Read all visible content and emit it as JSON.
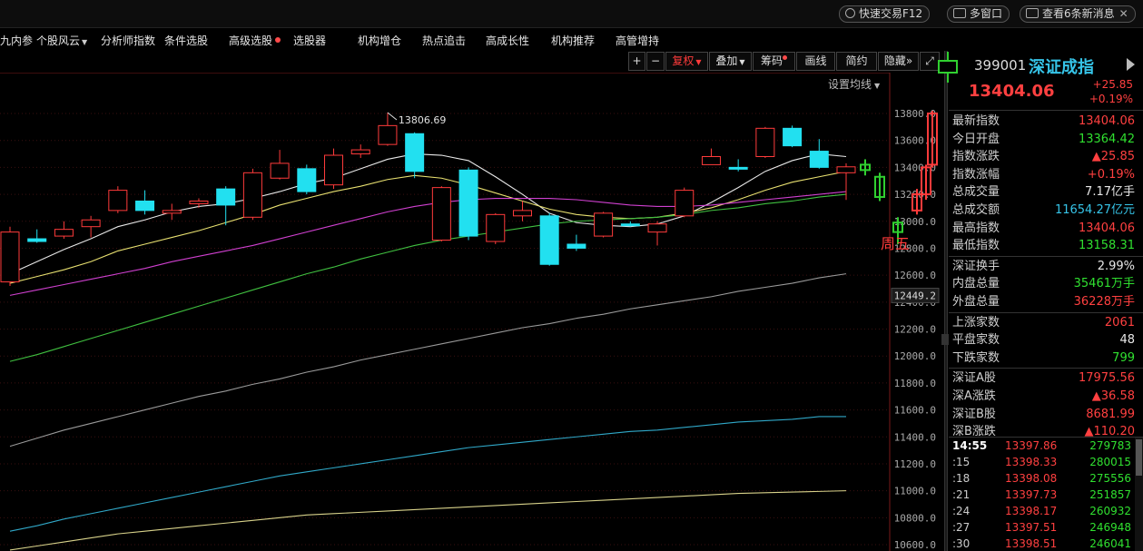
{
  "topbar": {
    "quick_trade": "快速交易F12",
    "multi_window": "多窗口",
    "news": "查看6条新消息"
  },
  "menu": [
    {
      "label": "九内参"
    },
    {
      "label": "个股风云",
      "caret": true
    },
    {
      "label": "分析师指数"
    },
    {
      "label": "条件选股"
    },
    {
      "label": "高级选股",
      "dot": true
    },
    {
      "label": "选股器"
    },
    {
      "label": "机构增仓"
    },
    {
      "label": "热点追击"
    },
    {
      "label": "高成长性"
    },
    {
      "label": "机构推荐"
    },
    {
      "label": "高管增持"
    }
  ],
  "toolbar": {
    "plus": "+",
    "minus": "−",
    "fuquan": "复权",
    "overlay": "叠加",
    "chips": "筹码",
    "draw": "画线",
    "simple": "简约",
    "hide": "隐藏",
    "hide_arrow": "»",
    "fullscreen": "⤢",
    "ma_setting": "设置均线"
  },
  "chart_data": {
    "type": "candlestick",
    "ylim": [
      10600,
      13900
    ],
    "y_ticks": [
      13800,
      13600,
      13400,
      13200,
      13000,
      12800,
      12600,
      12400,
      12200,
      12000,
      11800,
      11600,
      11400,
      11200,
      11000,
      10800,
      10600
    ],
    "y_tick_labels": [
      "13800.0",
      "13600.0",
      "13400.0",
      "13200.0",
      "13000.0",
      "12800.0",
      "12600.0",
      "12400.0",
      "12200.0",
      "12000.0",
      "11800.0",
      "11600.0",
      "11400.0",
      "11200.0",
      "11000.0",
      "10800.0",
      "10600.0"
    ],
    "current_price_tag": "12449.2",
    "current_price_value": 12449.2,
    "max_label": "13806.69",
    "max_value": 13806.69,
    "candles": [
      {
        "o": 12550,
        "c": 12920,
        "h": 12960,
        "l": 12520
      },
      {
        "o": 12870,
        "c": 12850,
        "h": 12940,
        "l": 12840
      },
      {
        "o": 12890,
        "c": 12940,
        "h": 13000,
        "l": 12870
      },
      {
        "o": 12960,
        "c": 13010,
        "h": 13040,
        "l": 12880
      },
      {
        "o": 13080,
        "c": 13230,
        "h": 13260,
        "l": 13060
      },
      {
        "o": 13150,
        "c": 13080,
        "h": 13230,
        "l": 13050
      },
      {
        "o": 13060,
        "c": 13080,
        "h": 13130,
        "l": 13010
      },
      {
        "o": 13130,
        "c": 13150,
        "h": 13170,
        "l": 13100
      },
      {
        "o": 13240,
        "c": 13120,
        "h": 13260,
        "l": 12970
      },
      {
        "o": 13030,
        "c": 13360,
        "h": 13390,
        "l": 13010
      },
      {
        "o": 13320,
        "c": 13430,
        "h": 13530,
        "l": 13310
      },
      {
        "o": 13390,
        "c": 13220,
        "h": 13420,
        "l": 13200
      },
      {
        "o": 13270,
        "c": 13490,
        "h": 13540,
        "l": 13240
      },
      {
        "o": 13500,
        "c": 13530,
        "h": 13570,
        "l": 13470
      },
      {
        "o": 13570,
        "c": 13710,
        "h": 13806,
        "l": 13560
      },
      {
        "o": 13650,
        "c": 13370,
        "h": 13660,
        "l": 13320
      },
      {
        "o": 12860,
        "c": 13250,
        "h": 13260,
        "l": 12850
      },
      {
        "o": 13380,
        "c": 12890,
        "h": 13400,
        "l": 12860
      },
      {
        "o": 12850,
        "c": 13050,
        "h": 13060,
        "l": 12830
      },
      {
        "o": 13040,
        "c": 13080,
        "h": 13150,
        "l": 13000
      },
      {
        "o": 13040,
        "c": 12680,
        "h": 13060,
        "l": 12670
      },
      {
        "o": 12830,
        "c": 12800,
        "h": 12900,
        "l": 12780
      },
      {
        "o": 12890,
        "c": 13060,
        "h": 13070,
        "l": 12880
      },
      {
        "o": 12980,
        "c": 12970,
        "h": 13000,
        "l": 12960
      },
      {
        "o": 12920,
        "c": 12980,
        "h": 13000,
        "l": 12820
      },
      {
        "o": 13040,
        "c": 13230,
        "h": 13250,
        "l": 13030
      },
      {
        "o": 13420,
        "c": 13480,
        "h": 13540,
        "l": 13420
      },
      {
        "o": 13400,
        "c": 13390,
        "h": 13460,
        "l": 13370
      },
      {
        "o": 13480,
        "c": 13690,
        "h": 13700,
        "l": 13470
      },
      {
        "o": 13690,
        "c": 13560,
        "h": 13710,
        "l": 13550
      },
      {
        "o": 13520,
        "c": 13400,
        "h": 13610,
        "l": 13390
      },
      {
        "o": 13360,
        "c": 13404,
        "h": 13430,
        "l": 13158
      }
    ],
    "ma_lines": [
      {
        "color": "#e8e8e8",
        "values": [
          12610,
          12700,
          12790,
          12870,
          12960,
          13010,
          13070,
          13110,
          13130,
          13170,
          13220,
          13280,
          13320,
          13390,
          13460,
          13500,
          13490,
          13450,
          13330,
          13200,
          13060,
          12990,
          12970,
          12960,
          12980,
          13040,
          13140,
          13250,
          13370,
          13450,
          13500,
          13480
        ]
      },
      {
        "color": "#e8e070",
        "values": [
          12540,
          12590,
          12640,
          12700,
          12780,
          12830,
          12880,
          12930,
          12990,
          13050,
          13120,
          13170,
          13220,
          13260,
          13310,
          13340,
          13320,
          13270,
          13210,
          13150,
          13090,
          13050,
          13030,
          13020,
          13030,
          13060,
          13100,
          13160,
          13230,
          13290,
          13330,
          13370
        ]
      },
      {
        "color": "#d040d0",
        "values": [
          12450,
          12490,
          12530,
          12570,
          12610,
          12650,
          12700,
          12740,
          12780,
          12820,
          12870,
          12920,
          12970,
          13020,
          13070,
          13110,
          13140,
          13160,
          13170,
          13170,
          13170,
          13160,
          13140,
          13120,
          13110,
          13110,
          13120,
          13140,
          13160,
          13180,
          13200,
          13220
        ]
      },
      {
        "color": "#40c040",
        "values": [
          11960,
          12010,
          12070,
          12130,
          12190,
          12250,
          12310,
          12370,
          12430,
          12490,
          12550,
          12610,
          12660,
          12720,
          12770,
          12820,
          12860,
          12890,
          12920,
          12950,
          12980,
          13000,
          13010,
          13020,
          13030,
          13050,
          13080,
          13100,
          13130,
          13150,
          13180,
          13200
        ]
      },
      {
        "color": "#9a9a9a",
        "values": [
          11330,
          11390,
          11450,
          11500,
          11550,
          11600,
          11650,
          11700,
          11740,
          11790,
          11830,
          11880,
          11920,
          11970,
          12010,
          12050,
          12090,
          12130,
          12170,
          12210,
          12240,
          12280,
          12310,
          12350,
          12380,
          12410,
          12440,
          12480,
          12510,
          12540,
          12580,
          12610
        ]
      },
      {
        "color": "#30a8c8",
        "values": [
          10700,
          10740,
          10790,
          10830,
          10870,
          10910,
          10950,
          10990,
          11030,
          11070,
          11110,
          11140,
          11170,
          11200,
          11230,
          11260,
          11290,
          11320,
          11340,
          11360,
          11380,
          11400,
          11420,
          11440,
          11450,
          11470,
          11490,
          11510,
          11520,
          11530,
          11550,
          11550
        ]
      },
      {
        "color": "#d8d28a",
        "values": [
          10560,
          10590,
          10620,
          10650,
          10680,
          10700,
          10720,
          10740,
          10760,
          10780,
          10800,
          10820,
          10830,
          10840,
          10850,
          10860,
          10870,
          10880,
          10890,
          10900,
          10910,
          10920,
          10930,
          10940,
          10950,
          10960,
          10970,
          10980,
          10985,
          10990,
          10995,
          11000
        ]
      }
    ],
    "forecast_candles": [
      {
        "o": 13380,
        "c": 13420,
        "h": 13460,
        "l": 13340
      },
      {
        "o": 13180,
        "c": 13330,
        "h": 13360,
        "l": 13150
      },
      {
        "o": 12920,
        "c": 12990,
        "h": 13030,
        "l": 12830
      },
      {
        "o": 13080,
        "c": 13200,
        "h": 13240,
        "l": 13050
      },
      {
        "o": 13200,
        "c": 13400,
        "h": 13420,
        "l": 13160
      },
      {
        "o": 13420,
        "c": 13800,
        "h": 13820,
        "l": 13400
      }
    ],
    "forecast_label": "周五"
  },
  "panel": {
    "code": "399001",
    "name": "深证成指",
    "price": "13404.06",
    "change": "+25.85",
    "change_pct": "+0.19%",
    "rows": [
      {
        "label": "最新指数",
        "value": "13404.06",
        "color": "#ff4040"
      },
      {
        "label": "今日开盘",
        "value": "13364.42",
        "color": "#30e030"
      },
      {
        "label": "指数涨跌",
        "value": "▲25.85",
        "color": "#ff4040"
      },
      {
        "label": "指数涨幅",
        "value": "+0.19%",
        "color": "#ff4040"
      },
      {
        "label": "总成交量",
        "value": "7.17亿手",
        "color": "#e8e8e8"
      },
      {
        "label": "总成交额",
        "value": "11654.27亿元",
        "color": "#36c4e8"
      },
      {
        "label": "最高指数",
        "value": "13404.06",
        "color": "#ff4040"
      },
      {
        "label": "最低指数",
        "value": "13158.31",
        "color": "#30e030"
      }
    ],
    "rows2": [
      {
        "label": "深证换手",
        "value": "2.99%",
        "color": "#e8e8e8"
      },
      {
        "label": "内盘总量",
        "value": "35461万手",
        "color": "#30e030"
      },
      {
        "label": "外盘总量",
        "value": "36228万手",
        "color": "#ff4040"
      }
    ],
    "rows3": [
      {
        "label": "上涨家数",
        "value": "2061",
        "color": "#ff4040"
      },
      {
        "label": "平盘家数",
        "value": "48",
        "color": "#e8e8e8"
      },
      {
        "label": "下跌家数",
        "value": "799",
        "color": "#30e030"
      }
    ],
    "rows4": [
      {
        "label": "深证A股",
        "value": "17975.56",
        "color": "#ff4040"
      },
      {
        "label": "深A涨跌",
        "value": "▲36.58",
        "color": "#ff4040"
      },
      {
        "label": "深证B股",
        "value": "8681.99",
        "color": "#ff4040"
      },
      {
        "label": "深B涨跌",
        "value": "▲110.20",
        "color": "#ff4040"
      }
    ],
    "ticks": [
      {
        "time": "14:55",
        "price": "13397.86",
        "vol": "279783"
      },
      {
        "time": ":15",
        "price": "13398.33",
        "vol": "280015"
      },
      {
        "time": ":18",
        "price": "13398.08",
        "vol": "275556"
      },
      {
        "time": ":21",
        "price": "13397.73",
        "vol": "251857"
      },
      {
        "time": ":24",
        "price": "13398.17",
        "vol": "260932"
      },
      {
        "time": ":27",
        "price": "13397.51",
        "vol": "246948"
      },
      {
        "time": ":30",
        "price": "13398.51",
        "vol": "246041"
      }
    ]
  }
}
